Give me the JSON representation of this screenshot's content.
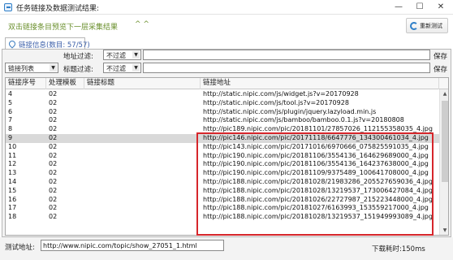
{
  "window": {
    "title": "任务链接及数据测试结果:",
    "minimize": "—",
    "maximize": "☐",
    "close": "✕"
  },
  "toolbar": {
    "hint": "双击链接条目预览下一层采集结果",
    "hint_arrows": "^ ^",
    "retest_label": "重新测试"
  },
  "tab": {
    "label": "链接信息(数目: 57/57)"
  },
  "filters": {
    "url_label": "地址过滤:",
    "url_mode": "不过滤",
    "list_mode": "链接列表",
    "title_label": "标题过滤:",
    "title_mode": "不过滤",
    "save1": "保存",
    "save2": "保存"
  },
  "table": {
    "columns": [
      "链接序号",
      "处理模板",
      "链接标题",
      "链接地址"
    ],
    "rows": [
      {
        "seq": "4",
        "tpl": "02",
        "title": "",
        "url": "http://static.nipic.com/js/widget.js?v=20170928"
      },
      {
        "seq": "5",
        "tpl": "02",
        "title": "",
        "url": "http://static.nipic.com/js/tool.js?v=20170928"
      },
      {
        "seq": "6",
        "tpl": "02",
        "title": "",
        "url": "http://static.nipic.com/js/plugin/jquery.lazyload.min.js"
      },
      {
        "seq": "7",
        "tpl": "02",
        "title": "",
        "url": "http://static.nipic.com/js/bamboo/bamboo.0.1.js?v=20180808"
      },
      {
        "seq": "8",
        "tpl": "02",
        "title": "",
        "url": "http://pic189.nipic.com/pic/20181101/27857026_112155358035_4.jpg"
      },
      {
        "seq": "9",
        "tpl": "02",
        "title": "",
        "url": "http://pic146.nipic.com/pic/20171118/6647776_134300461034_4.jpg",
        "selected": true
      },
      {
        "seq": "10",
        "tpl": "02",
        "title": "",
        "url": "http://pic143.nipic.com/pic/20171016/6970666_075825591035_4.jpg"
      },
      {
        "seq": "11",
        "tpl": "02",
        "title": "",
        "url": "http://pic190.nipic.com/pic/20181106/3554136_164629689000_4.jpg"
      },
      {
        "seq": "12",
        "tpl": "02",
        "title": "",
        "url": "http://pic190.nipic.com/pic/20181106/3554136_164237638000_4.jpg"
      },
      {
        "seq": "13",
        "tpl": "02",
        "title": "",
        "url": "http://pic190.nipic.com/pic/20181109/9375489_100641708000_4.jpg"
      },
      {
        "seq": "14",
        "tpl": "02",
        "title": "",
        "url": "http://pic188.nipic.com/pic/20181028/21983286_205527659036_4.jpg"
      },
      {
        "seq": "15",
        "tpl": "02",
        "title": "",
        "url": "http://pic188.nipic.com/pic/20181028/13219537_173006427084_4.jpg"
      },
      {
        "seq": "16",
        "tpl": "02",
        "title": "",
        "url": "http://pic188.nipic.com/pic/20181026/22727987_215223448000_4.jpg"
      },
      {
        "seq": "17",
        "tpl": "02",
        "title": "",
        "url": "http://pic188.nipic.com/pic/20181027/6163993_153559217000_4.jpg"
      },
      {
        "seq": "18",
        "tpl": "02",
        "title": "",
        "url": "http://pic188.nipic.com/pic/20181028/13219537_151949993089_4.jpg"
      }
    ]
  },
  "status": {
    "label": "测试地址:",
    "url": "http://www.nipic.com/topic/show_27051_1.html",
    "time": "下载耗时:150ms"
  }
}
